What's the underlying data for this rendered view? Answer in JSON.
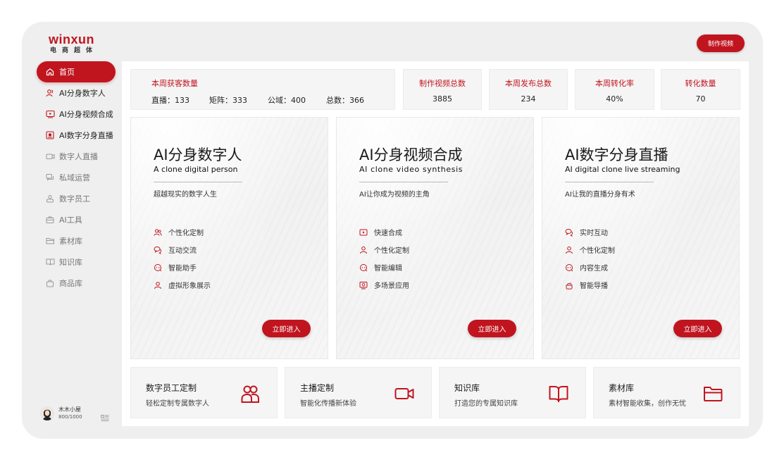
{
  "brand": {
    "name": "winxun",
    "subtitle": "电商超体"
  },
  "header": {
    "make_video_label": "制作视频"
  },
  "sidebar": {
    "items": [
      {
        "label": "首页",
        "icon": "home-icon",
        "state": "active"
      },
      {
        "label": "AI分身数字人",
        "icon": "user-icon",
        "state": "strong"
      },
      {
        "label": "AI分身视频合成",
        "icon": "video-icon",
        "state": "strong"
      },
      {
        "label": "AI数字分身直播",
        "icon": "live-icon",
        "state": "strong"
      },
      {
        "label": "数字人直播",
        "icon": "camera-icon",
        "state": "normal"
      },
      {
        "label": "私域运营",
        "icon": "chat-icon",
        "state": "normal"
      },
      {
        "label": "数字员工",
        "icon": "users-icon",
        "state": "normal"
      },
      {
        "label": "AI工具",
        "icon": "toolbox-icon",
        "state": "normal"
      },
      {
        "label": "素材库",
        "icon": "folder-icon",
        "state": "normal"
      },
      {
        "label": "知识库",
        "icon": "book-icon",
        "state": "normal"
      },
      {
        "label": "商品库",
        "icon": "bag-icon",
        "state": "normal"
      }
    ]
  },
  "user": {
    "name": "木木小屋",
    "quota": "800/1000"
  },
  "stats": {
    "weekly_customers": {
      "title": "本周获客数量",
      "live": "直播：133",
      "matrix": "矩阵：333",
      "public": "公域：400",
      "total": "总数：366"
    },
    "videos_made": {
      "title": "制作视频总数",
      "value": "3885"
    },
    "weekly_published": {
      "title": "本周发布总数",
      "value": "234"
    },
    "weekly_conversion_rate": {
      "title": "本周转化率",
      "value": "40%"
    },
    "conversions": {
      "title": "转化数量",
      "value": "70"
    }
  },
  "cards": [
    {
      "title": "AI分身数字人",
      "subtitle_en": "A clone digital person",
      "desc": "超越现实的数字人生",
      "features": [
        "个性化定制",
        "互动交流",
        "智能助手",
        "虚拟形象展示"
      ],
      "enter_label": "立即进入"
    },
    {
      "title": "AI分身视频合成",
      "subtitle_en": "AI clone video synthesis",
      "desc": "AI让你成为视频的主角",
      "features": [
        "快速合成",
        "个性化定制",
        "智能编辑",
        "多场景应用"
      ],
      "enter_label": "立即进入"
    },
    {
      "title": "AI数字分身直播",
      "subtitle_en": "AI digital clone live streaming",
      "desc": "AI让我的直播分身有术",
      "features": [
        "实时互动",
        "个性化定制",
        "内容生成",
        "智能导播"
      ],
      "enter_label": "立即进入"
    }
  ],
  "tiles": [
    {
      "title": "数字员工定制",
      "subtitle": "轻松定制专属数字人",
      "icon": "users-icon"
    },
    {
      "title": "主播定制",
      "subtitle": "智能化传播新体验",
      "icon": "video-camera-icon"
    },
    {
      "title": "知识库",
      "subtitle": "打造您的专属知识库",
      "icon": "book-icon"
    },
    {
      "title": "素材库",
      "subtitle": "素材智能收集，创作无忧",
      "icon": "folder-icon"
    }
  ],
  "colors": {
    "accent": "#c0151f",
    "frame": "#efefef",
    "panel": "#ffffff",
    "card": "#f5f5f5"
  }
}
